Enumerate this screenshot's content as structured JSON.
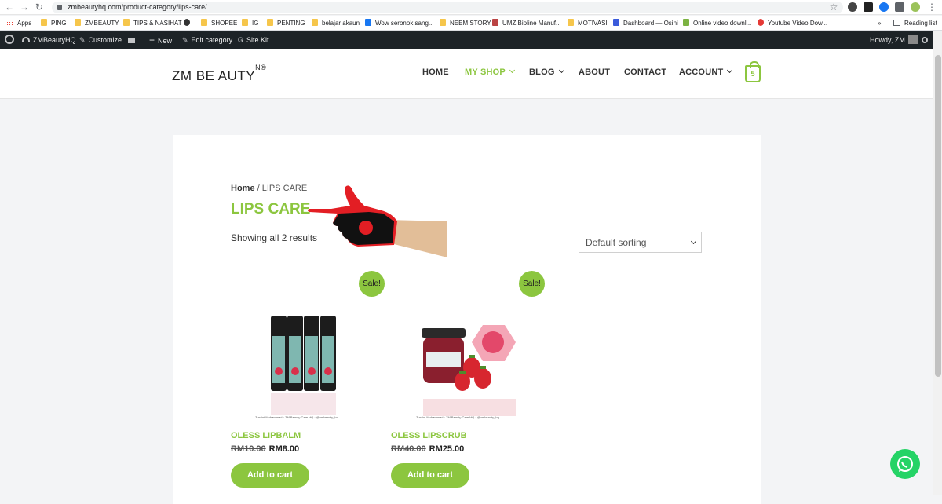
{
  "browser": {
    "url": "zmbeautyhq.com/product-category/lips-care/",
    "bookmarks": [
      "Apps",
      "PING",
      "ZMBEAUTY",
      "TIPS & NASIHAT",
      "SHOPEE",
      "IG",
      "PENTING",
      "belajar akaun",
      "Wow seronok sang...",
      "NEEM STORY",
      "UMZ Bioline Manuf...",
      "MOTIVASI",
      "Dashboard — Osini",
      "Online video downl...",
      "Youtube Video Dow..."
    ],
    "reading_list": "Reading list",
    "more_chevron": "»"
  },
  "wp_admin": {
    "site": "ZMBeautyHQ",
    "customize": "Customize",
    "new": "New",
    "edit_category": "Edit category",
    "site_kit": "Site Kit",
    "howdy": "Howdy, ZM"
  },
  "header": {
    "logo_main": "ZM BE AUTY",
    "logo_mark": "N®",
    "menu": [
      "HOME",
      "MY SHOP",
      "BLOG",
      "ABOUT",
      "CONTACT",
      "ACCOUNT"
    ],
    "cart_count": "5"
  },
  "page": {
    "breadcrumb_home": "Home",
    "breadcrumb_sep": " / ",
    "breadcrumb_current": "LIPS CARE",
    "title": "LIPS CARE",
    "result_count": "Showing all 2 results",
    "sort_selected": "Default sorting"
  },
  "products": [
    {
      "name": "OLESS LIPBALM",
      "old_price": "RM10.00",
      "new_price": "RM8.00",
      "badge": "Sale!",
      "button": "Add to cart",
      "img_footer": "Zuraini Muhammad · ZM Beauty Care HQ · @zmbeauty_hq"
    },
    {
      "name": "OLESS LIPSCRUB",
      "old_price": "RM40.00",
      "new_price": "RM25.00",
      "badge": "Sale!",
      "button": "Add to cart",
      "img_footer": "Zuraini Muhammad · ZM Beauty Care HQ · @zmbeauty_hq"
    }
  ],
  "colors": {
    "accent": "#8cc63f",
    "wp_bar": "#1d2327",
    "whatsapp": "#25d366"
  }
}
